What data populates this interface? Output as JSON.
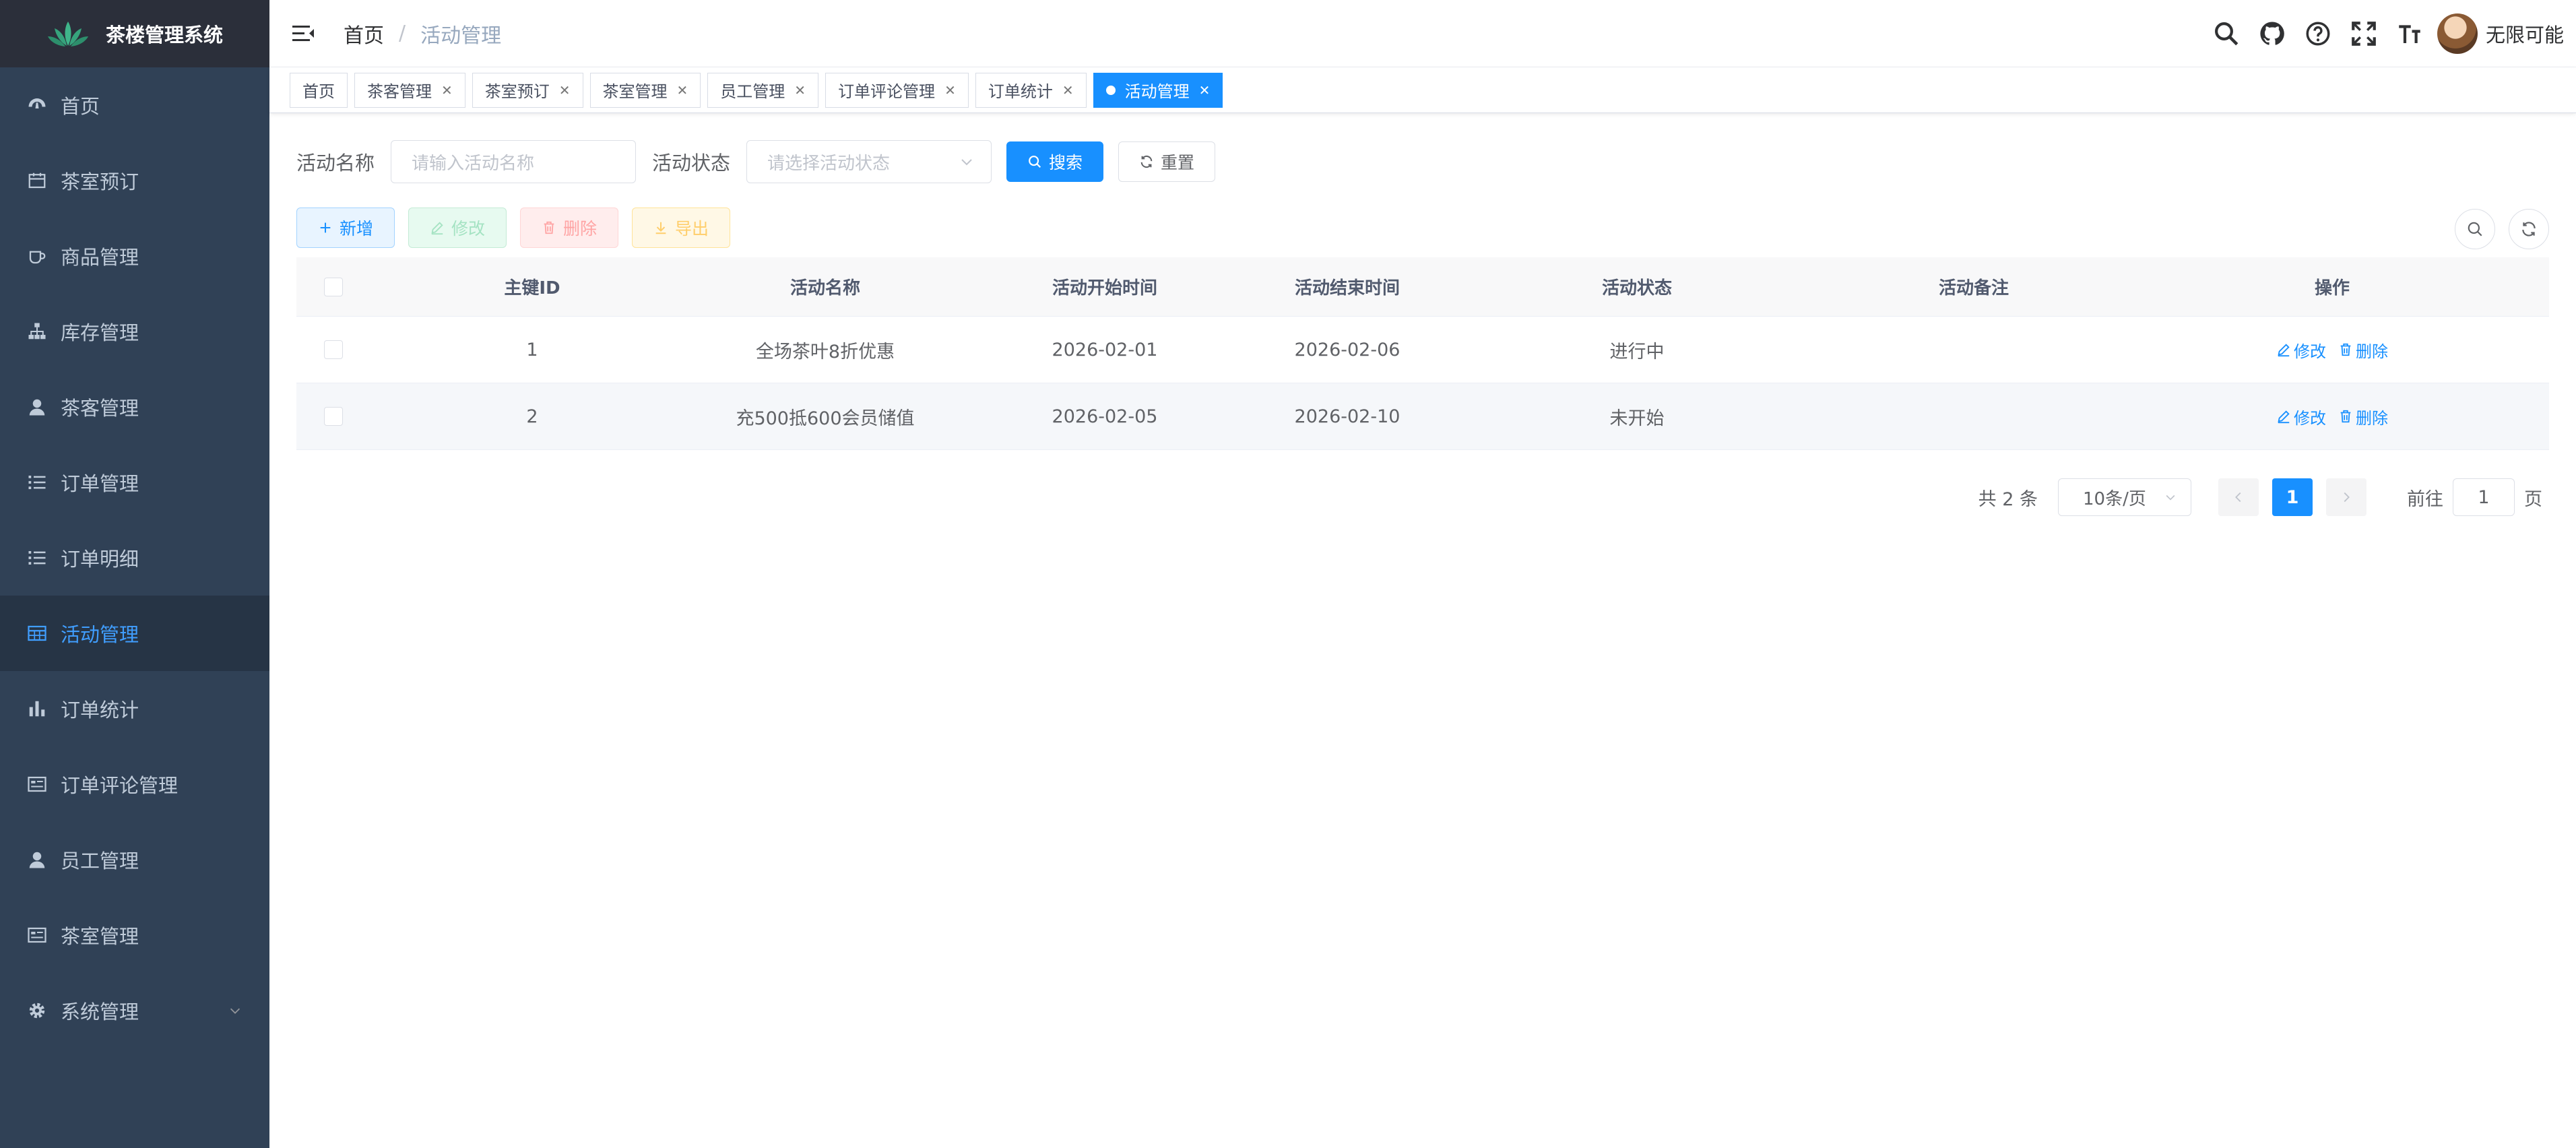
{
  "app": {
    "title": "茶楼管理系统"
  },
  "sidebar": {
    "items": [
      {
        "label": "首页",
        "icon": "dashboard-icon",
        "active": false
      },
      {
        "label": "茶室预订",
        "icon": "calendar-icon",
        "active": false
      },
      {
        "label": "商品管理",
        "icon": "cup-icon",
        "active": false
      },
      {
        "label": "库存管理",
        "icon": "tree-icon",
        "active": false
      },
      {
        "label": "茶客管理",
        "icon": "user-icon",
        "active": false
      },
      {
        "label": "订单管理",
        "icon": "list-icon",
        "active": false
      },
      {
        "label": "订单明细",
        "icon": "list-icon",
        "active": false
      },
      {
        "label": "活动管理",
        "icon": "table-icon",
        "active": true
      },
      {
        "label": "订单统计",
        "icon": "bar-chart-icon",
        "active": false
      },
      {
        "label": "订单评论管理",
        "icon": "form-icon",
        "active": false
      },
      {
        "label": "员工管理",
        "icon": "user-icon",
        "active": false
      },
      {
        "label": "茶室管理",
        "icon": "form-icon",
        "active": false
      },
      {
        "label": "系统管理",
        "icon": "gear-icon",
        "active": false,
        "expandable": true
      }
    ]
  },
  "navbar": {
    "breadcrumb": {
      "home": "首页",
      "separator": "/",
      "current": "活动管理"
    },
    "user_name": "无限可能"
  },
  "tags": [
    {
      "label": "首页",
      "closable": false,
      "active": false
    },
    {
      "label": "茶客管理",
      "closable": true,
      "active": false
    },
    {
      "label": "茶室预订",
      "closable": true,
      "active": false
    },
    {
      "label": "茶室管理",
      "closable": true,
      "active": false
    },
    {
      "label": "员工管理",
      "closable": true,
      "active": false
    },
    {
      "label": "订单评论管理",
      "closable": true,
      "active": false
    },
    {
      "label": "订单统计",
      "closable": true,
      "active": false
    },
    {
      "label": "活动管理",
      "closable": true,
      "active": true
    }
  ],
  "search": {
    "name_label": "活动名称",
    "name_placeholder": "请输入活动名称",
    "status_label": "活动状态",
    "status_placeholder": "请选择活动状态",
    "search_button": "搜索",
    "reset_button": "重置"
  },
  "toolbar": {
    "add": "新增",
    "edit": "修改",
    "delete": "删除",
    "export": "导出"
  },
  "table": {
    "columns": [
      "主键ID",
      "活动名称",
      "活动开始时间",
      "活动结束时间",
      "活动状态",
      "活动备注",
      "操作"
    ],
    "rows": [
      {
        "id": "1",
        "name": "全场茶叶8折优惠",
        "start": "2026-02-01",
        "end": "2026-02-06",
        "status": "进行中",
        "remark": "",
        "edit": "修改",
        "delete": "删除"
      },
      {
        "id": "2",
        "name": "充500抵600会员储值",
        "start": "2026-02-05",
        "end": "2026-02-10",
        "status": "未开始",
        "remark": "",
        "edit": "修改",
        "delete": "删除"
      }
    ]
  },
  "pagination": {
    "total": "共 2 条",
    "page_size": "10条/页",
    "current_page": "1",
    "goto_label": "前往",
    "goto_value": "1",
    "page_suffix": "页"
  },
  "colors": {
    "sidebar_bg": "#304156",
    "primary": "#1890ff",
    "active_menu_text": "#409eff"
  }
}
